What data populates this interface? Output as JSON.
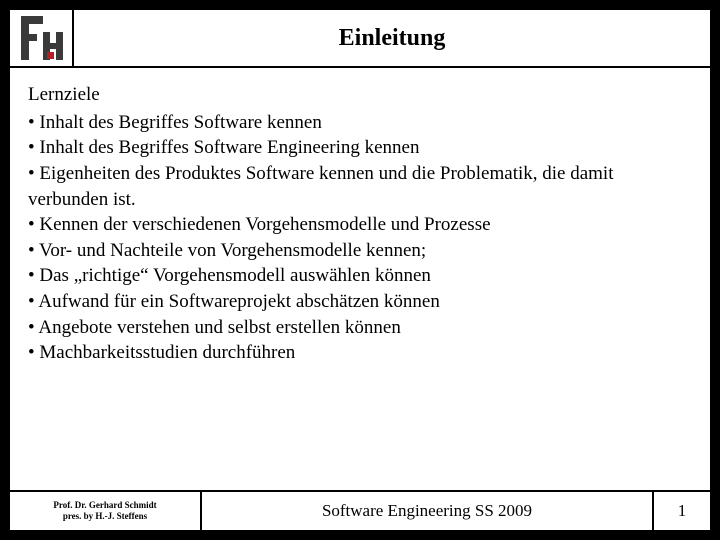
{
  "header": {
    "title": "Einleitung"
  },
  "body": {
    "subhead": "Lernziele",
    "bullets": [
      "• Inhalt des Begriffes Software kennen",
      "• Inhalt des Begriffes Software Engineering kennen",
      "• Eigenheiten des Produktes Software kennen und die Problematik, die damit verbunden ist.",
      "• Kennen der verschiedenen Vorgehensmodelle und Prozesse",
      "• Vor- und Nachteile von Vorgehensmodelle kennen;",
      "• Das „richtige“ Vorgehensmodell auswählen können",
      "• Aufwand für ein Softwareprojekt abschätzen können",
      "• Angebote verstehen und selbst erstellen können",
      "• Machbarkeitsstudien durchführen"
    ]
  },
  "footer": {
    "author_line1": "Prof. Dr. Gerhard Schmidt",
    "author_line2": "pres. by H.-J. Steffens",
    "course": "Software Engineering SS 2009",
    "page": "1"
  }
}
